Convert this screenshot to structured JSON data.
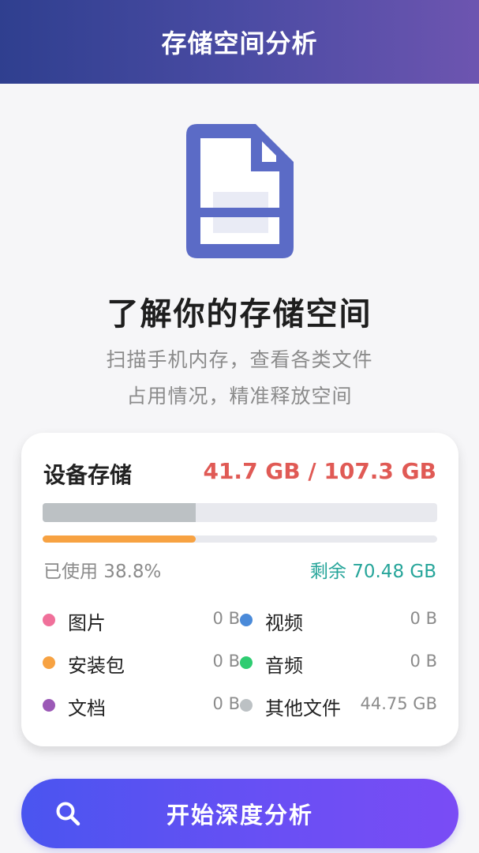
{
  "header": {
    "title": "存储空间分析"
  },
  "hero": {
    "title": "了解你的存储空间",
    "subtitle_line1": "扫描手机内存，查看各类文件",
    "subtitle_line2": "占用情况，精准释放空间"
  },
  "storage": {
    "title": "设备存储",
    "usage": "41.7 GB / 107.3 GB",
    "used_label": "已使用 38.8%",
    "used_fraction": 0.388,
    "remaining_label": "剩余 70.48 GB",
    "categories": [
      {
        "name": "图片",
        "size": "0 B",
        "color": "#f0709a"
      },
      {
        "name": "视频",
        "size": "0 B",
        "color": "#4a8ad9"
      },
      {
        "name": "安装包",
        "size": "0 B",
        "color": "#f7a242"
      },
      {
        "name": "音频",
        "size": "0 B",
        "color": "#2ecc71"
      },
      {
        "name": "文档",
        "size": "0 B",
        "color": "#9b59b6"
      },
      {
        "name": "其他文件",
        "size": "44.75 GB",
        "color": "#bcc1c4"
      }
    ]
  },
  "button": {
    "label": "开始深度分析",
    "icon": "search-icon"
  },
  "colors": {
    "accent": "#5b6bd6",
    "usage_red": "#e05a55",
    "remain_teal": "#26a59a"
  }
}
